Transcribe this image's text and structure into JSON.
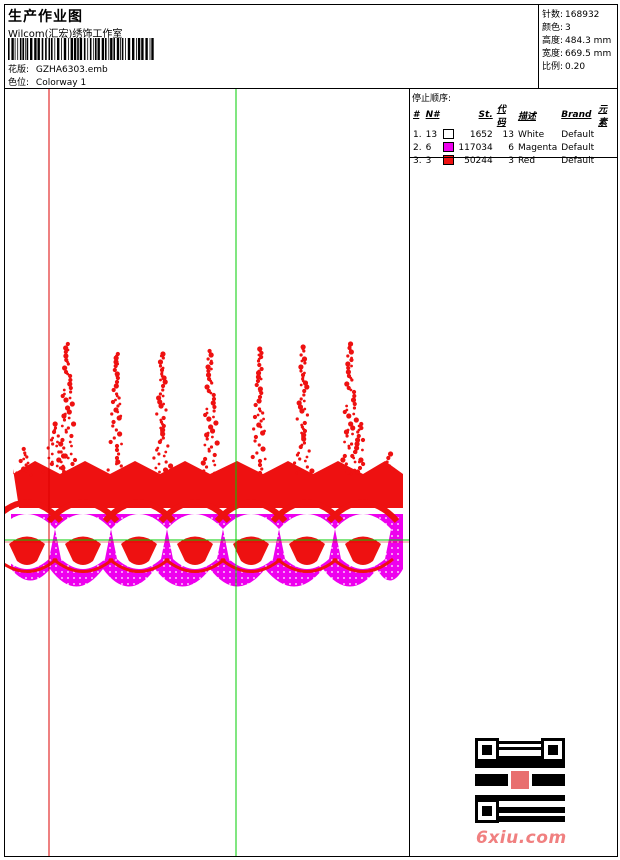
{
  "header": {
    "title": "生产作业图",
    "subtitle": "Wilcom(汇宏)绣饰工作室",
    "design_label": "花版:",
    "design_value": "GZHA6303.emb",
    "colorway_label": "色位:",
    "colorway_value": "Colorway 1"
  },
  "stats": [
    {
      "label": "针数:",
      "value": "168932"
    },
    {
      "label": "颜色:",
      "value": "3"
    },
    {
      "label": "高度:",
      "value": "484.3 mm"
    },
    {
      "label": "宽度:",
      "value": "669.5 mm"
    },
    {
      "label": "比例:",
      "value": "0.20"
    }
  ],
  "stop_sequence": {
    "title": "停止顺序:",
    "columns": [
      "#",
      "N#",
      "St.",
      "代码",
      "描述",
      "Brand",
      "元素"
    ],
    "rows": [
      {
        "idx": "1.",
        "n": "13",
        "color": "#ffffff",
        "st": "1652",
        "code": "13",
        "desc": "White",
        "brand": "Default"
      },
      {
        "idx": "2.",
        "n": "6",
        "color": "#ee00ee",
        "st": "117034",
        "code": "6",
        "desc": "Magenta",
        "brand": "Default"
      },
      {
        "idx": "3.",
        "n": "3",
        "color": "#ee1111",
        "st": "50244",
        "code": "3",
        "desc": "Red",
        "brand": "Default"
      }
    ]
  },
  "watermark": "6xiu.com",
  "colors": {
    "red": "#ee1111",
    "magenta": "#ee00ee",
    "green_guide": "#00cc00",
    "red_guide": "#dd0000"
  }
}
